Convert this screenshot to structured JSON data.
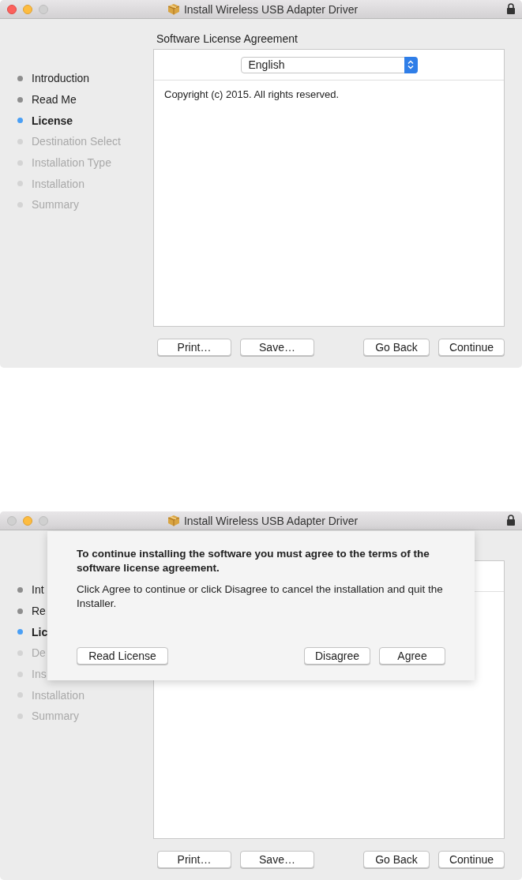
{
  "windows": [
    {
      "title": "Install Wireless USB Adapter Driver",
      "traffic_lights": [
        {
          "kind": "close",
          "enabled": true
        },
        {
          "kind": "minimize",
          "enabled": true
        },
        {
          "kind": "zoom",
          "enabled": false
        }
      ],
      "sidebar": {
        "items": [
          {
            "label": "Introduction",
            "selected": false,
            "disabled": false
          },
          {
            "label": "Read Me",
            "selected": false,
            "disabled": false
          },
          {
            "label": "License",
            "selected": true,
            "disabled": false
          },
          {
            "label": "Destination Select",
            "selected": false,
            "disabled": true
          },
          {
            "label": "Installation Type",
            "selected": false,
            "disabled": true
          },
          {
            "label": "Installation",
            "selected": false,
            "disabled": true
          },
          {
            "label": "Summary",
            "selected": false,
            "disabled": true
          }
        ]
      },
      "pane": {
        "heading": "Software License Agreement",
        "language_popup": {
          "value": "English"
        },
        "text": "Copyright (c) 2015.  All rights reserved."
      },
      "buttons_left": [
        "Print…",
        "Save…"
      ],
      "buttons_right": [
        "Go Back",
        "Continue"
      ]
    },
    {
      "title": "Install Wireless USB Adapter Driver",
      "traffic_lights": [
        {
          "kind": "close",
          "enabled": false
        },
        {
          "kind": "minimize",
          "enabled": true
        },
        {
          "kind": "zoom",
          "enabled": false
        }
      ],
      "sidebar": {
        "items": [
          {
            "label": "Int",
            "selected": false,
            "disabled": false
          },
          {
            "label": "Re",
            "selected": false,
            "disabled": false
          },
          {
            "label": "Lic",
            "selected": true,
            "disabled": false
          },
          {
            "label": "De",
            "selected": false,
            "disabled": true
          },
          {
            "label": "Ins",
            "selected": false,
            "disabled": true
          },
          {
            "label": "Installation",
            "selected": false,
            "disabled": true
          },
          {
            "label": "Summary",
            "selected": false,
            "disabled": true
          }
        ]
      },
      "buttons_left": [
        "Print…",
        "Save…"
      ],
      "buttons_right": [
        "Go Back",
        "Continue"
      ],
      "sheet": {
        "heading": "To continue installing the software you must agree to the terms of the software license agreement.",
        "message": "Click Agree to continue or click Disagree to cancel the installation and quit the Installer.",
        "buttons_left": [
          "Read License"
        ],
        "buttons_right": [
          "Disagree",
          "Agree"
        ]
      }
    }
  ]
}
